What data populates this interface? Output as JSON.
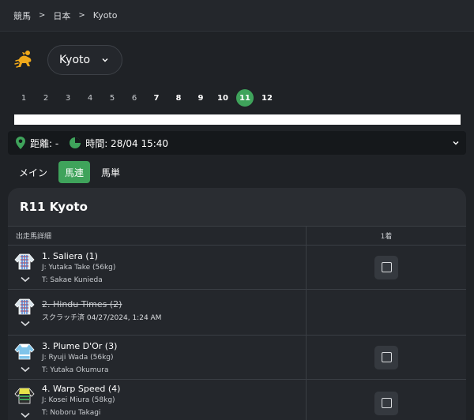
{
  "breadcrumb": [
    "競馬",
    "日本",
    "Kyoto"
  ],
  "venue": {
    "selected": "Kyoto"
  },
  "races": [
    {
      "num": "1",
      "state": "past"
    },
    {
      "num": "2",
      "state": "past"
    },
    {
      "num": "3",
      "state": "past"
    },
    {
      "num": "4",
      "state": "past"
    },
    {
      "num": "5",
      "state": "past"
    },
    {
      "num": "6",
      "state": "past"
    },
    {
      "num": "7",
      "state": "future"
    },
    {
      "num": "8",
      "state": "future"
    },
    {
      "num": "9",
      "state": "future"
    },
    {
      "num": "10",
      "state": "future"
    },
    {
      "num": "11",
      "state": "active"
    },
    {
      "num": "12",
      "state": "future"
    }
  ],
  "info": {
    "distance": "距離: -",
    "time": "時間: 28/04 15:40"
  },
  "tabs": [
    {
      "label": "メイン",
      "active": false
    },
    {
      "label": "馬連",
      "active": true
    },
    {
      "label": "馬単",
      "active": false
    }
  ],
  "card": {
    "title": "R11 Kyoto",
    "col_runner": "出走馬詳細",
    "col_first": "1着"
  },
  "runners": [
    {
      "name": "1. Saliera (1)",
      "jockey": "J: Yutaka Take (56kg)",
      "trainer": "T: Sakae Kunieda",
      "scratched": false
    },
    {
      "name": "2. Hindu Times (2)",
      "note": "スクラッチ済 04/27/2024, 1:24 AM",
      "scratched": true
    },
    {
      "name": "3. Plume D'Or (3)",
      "jockey": "J: Ryuji Wada (56kg)",
      "trainer": "T: Yutaka Okumura",
      "scratched": false
    },
    {
      "name": "4. Warp Speed (4)",
      "jockey": "J: Kosei Miura (58kg)",
      "trainer": "T: Noboru Takagi",
      "scratched": false
    }
  ],
  "colors": {
    "accent": "#3fa35b",
    "icon_orange": "#f0a91b",
    "background": "#1f2226",
    "card": "#2a2d32"
  }
}
